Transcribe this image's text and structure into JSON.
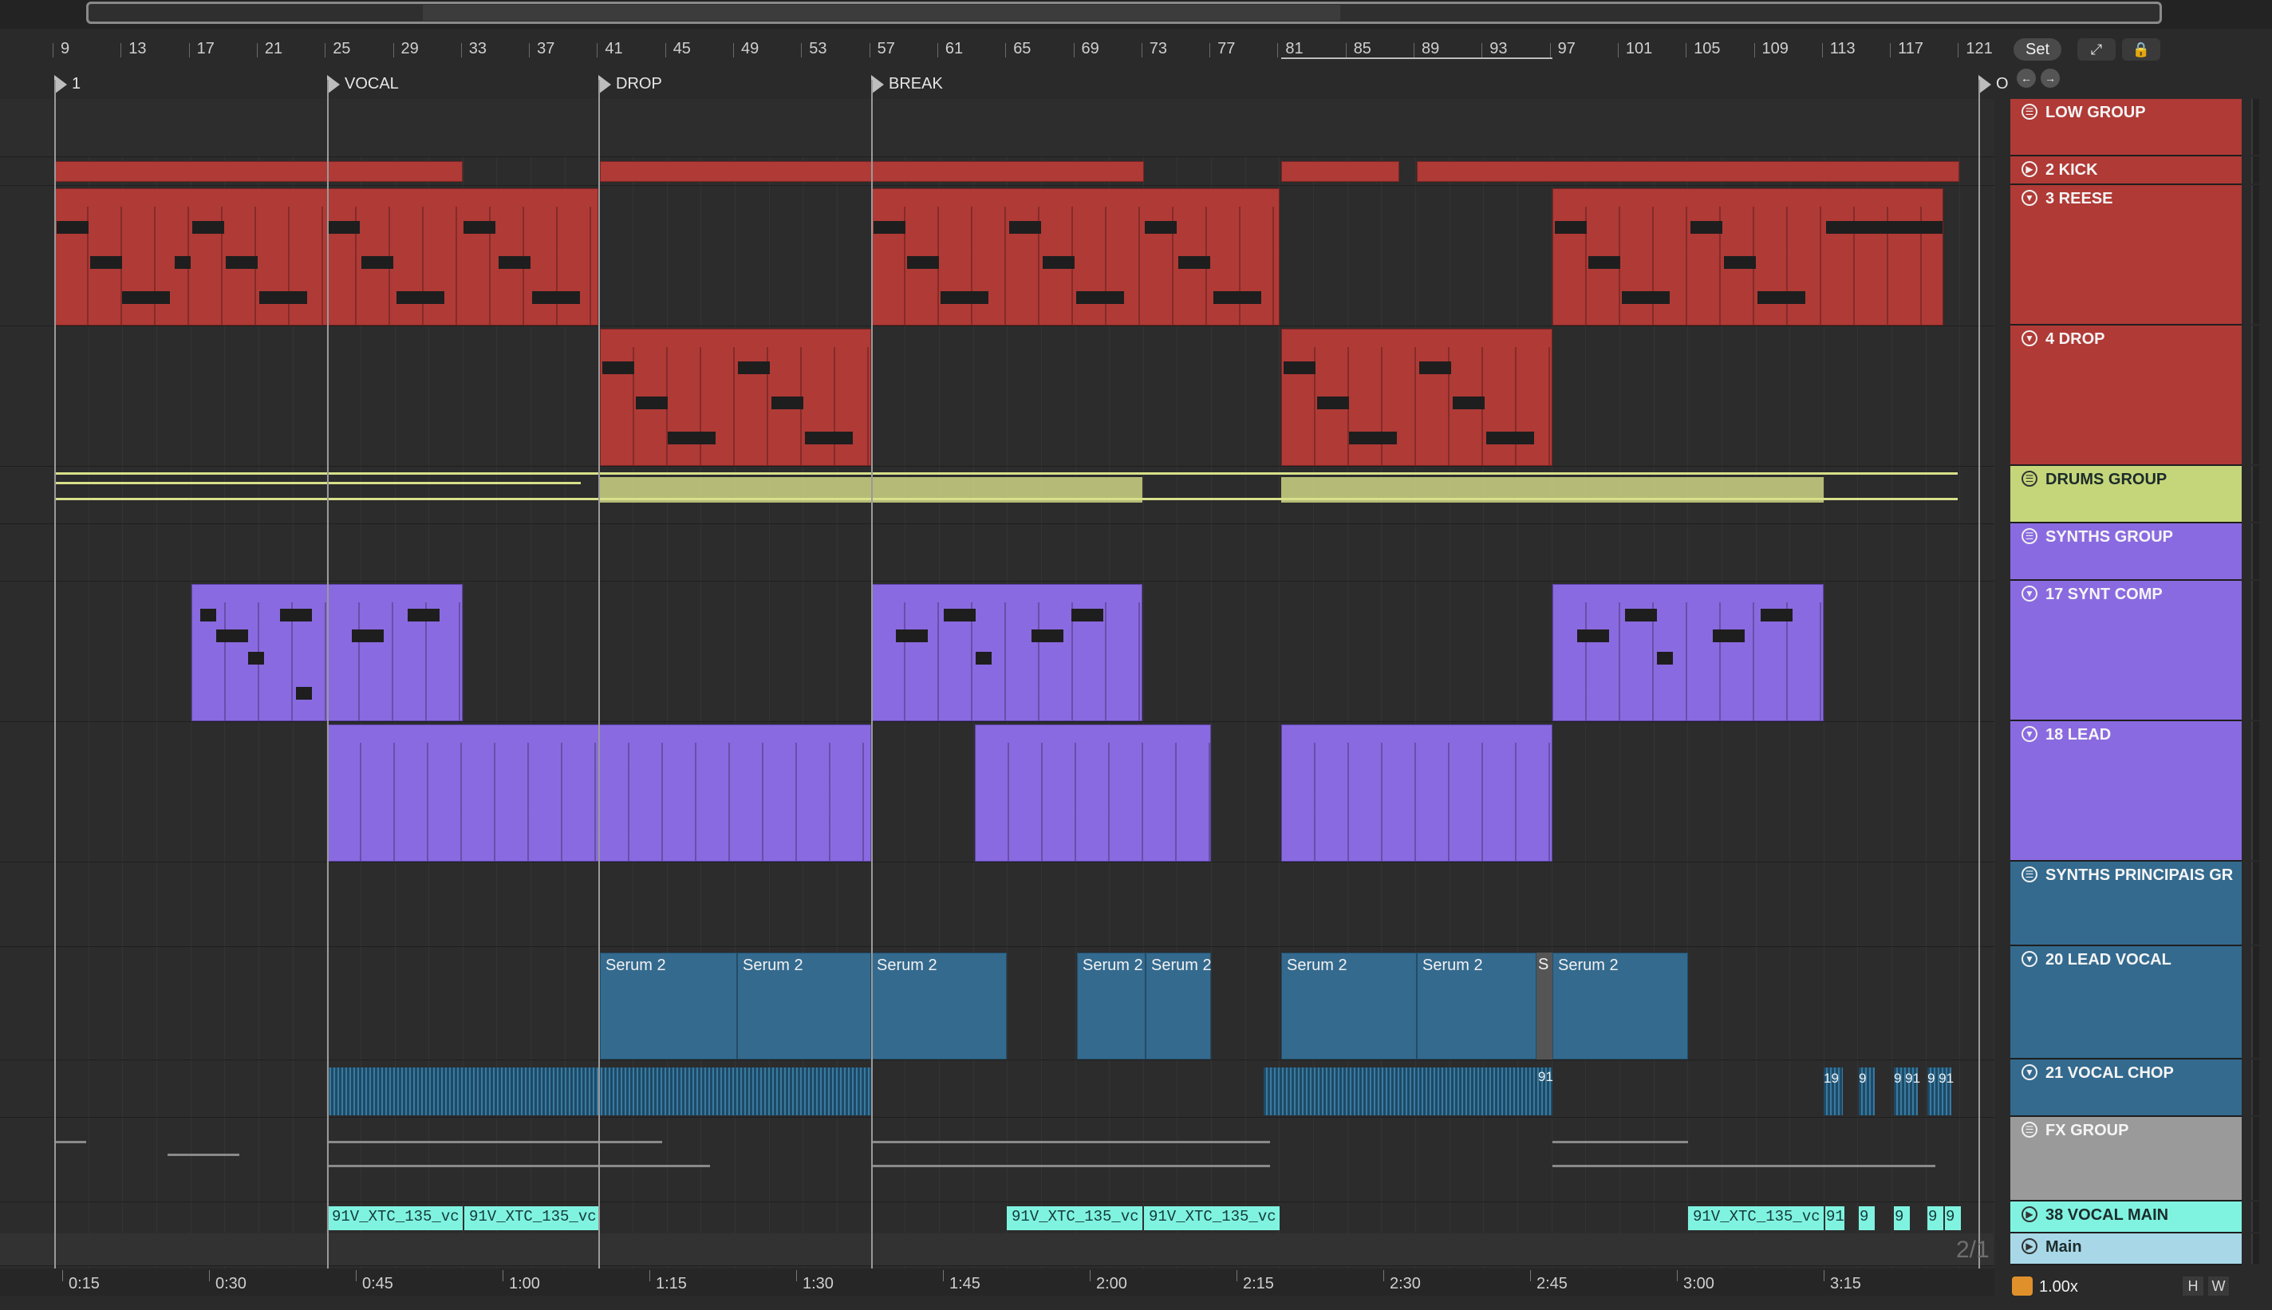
{
  "overview": {},
  "ruler": {
    "bars": [
      "9",
      "13",
      "17",
      "21",
      "25",
      "29",
      "33",
      "37",
      "41",
      "45",
      "49",
      "53",
      "57",
      "61",
      "65",
      "69",
      "73",
      "77",
      "81",
      "85",
      "89",
      "93",
      "97",
      "101",
      "105",
      "109",
      "113",
      "117",
      "121"
    ]
  },
  "locators": [
    {
      "label": "1"
    },
    {
      "label": "VOCAL"
    },
    {
      "label": "DROP"
    },
    {
      "label": "BREAK"
    },
    {
      "label": "O"
    }
  ],
  "toolbar": {
    "set_label": "Set",
    "expand_icon": "expand-icon",
    "lock_icon": "lock-icon"
  },
  "tracks": [
    {
      "name": "LOW GROUP",
      "color": "#b03a36",
      "icon": "group-icon"
    },
    {
      "name": "2 KICK",
      "color": "#b03a36",
      "icon": "play-icon"
    },
    {
      "name": "3 REESE",
      "color": "#b03a36",
      "icon": "fold-icon"
    },
    {
      "name": "4 DROP",
      "color": "#b03a36",
      "icon": "fold-icon"
    },
    {
      "name": "DRUMS GROUP",
      "color": "#c5d67a",
      "icon": "group-icon"
    },
    {
      "name": "SYNTHS GROUP",
      "color": "#8a6ae0",
      "icon": "group-icon"
    },
    {
      "name": "17 SYNT COMP",
      "color": "#8a6ae0",
      "icon": "fold-icon"
    },
    {
      "name": "18 LEAD",
      "color": "#8a6ae0",
      "icon": "fold-icon"
    },
    {
      "name": "SYNTHS PRINCIPAIS GR",
      "color": "#346a8e",
      "icon": "group-icon"
    },
    {
      "name": "20 LEAD VOCAL",
      "color": "#346a8e",
      "icon": "fold-icon"
    },
    {
      "name": "21 VOCAL CHOP",
      "color": "#346a8e",
      "icon": "fold-icon"
    },
    {
      "name": "FX GROUP",
      "color": "#9a9a9a",
      "icon": "group-icon"
    },
    {
      "name": "38 VOCAL MAIN",
      "color": "#7ff3e0",
      "icon": "play-icon"
    },
    {
      "name": "Main",
      "color": "#a8d8e8",
      "icon": "play-icon"
    }
  ],
  "clips": {
    "serum": [
      "Serum 2",
      "Serum 2",
      "Serum 2",
      "Serum 2",
      "Serum 2",
      "Serum 2",
      "Serum 2",
      "S",
      "Serum 2"
    ],
    "vocal_main": [
      "91V_XTC_135_vc",
      "91V_XTC_135_vc",
      "91V_XTC_135_vc",
      "91V_XTC_135_vc",
      "91V_XTC_135_vc",
      "91",
      "9",
      "9",
      "9",
      "9"
    ],
    "chop_tags": [
      "91",
      "19",
      "9",
      "9 91",
      "9 91"
    ]
  },
  "time_ruler": [
    "0:15",
    "0:30",
    "0:45",
    "1:00",
    "1:15",
    "1:30",
    "1:45",
    "2:00",
    "2:15",
    "2:30",
    "2:45",
    "3:00",
    "3:15"
  ],
  "status": {
    "page": "2/1",
    "zoom": "1.00x",
    "h_btn": "H",
    "w_btn": "W"
  }
}
